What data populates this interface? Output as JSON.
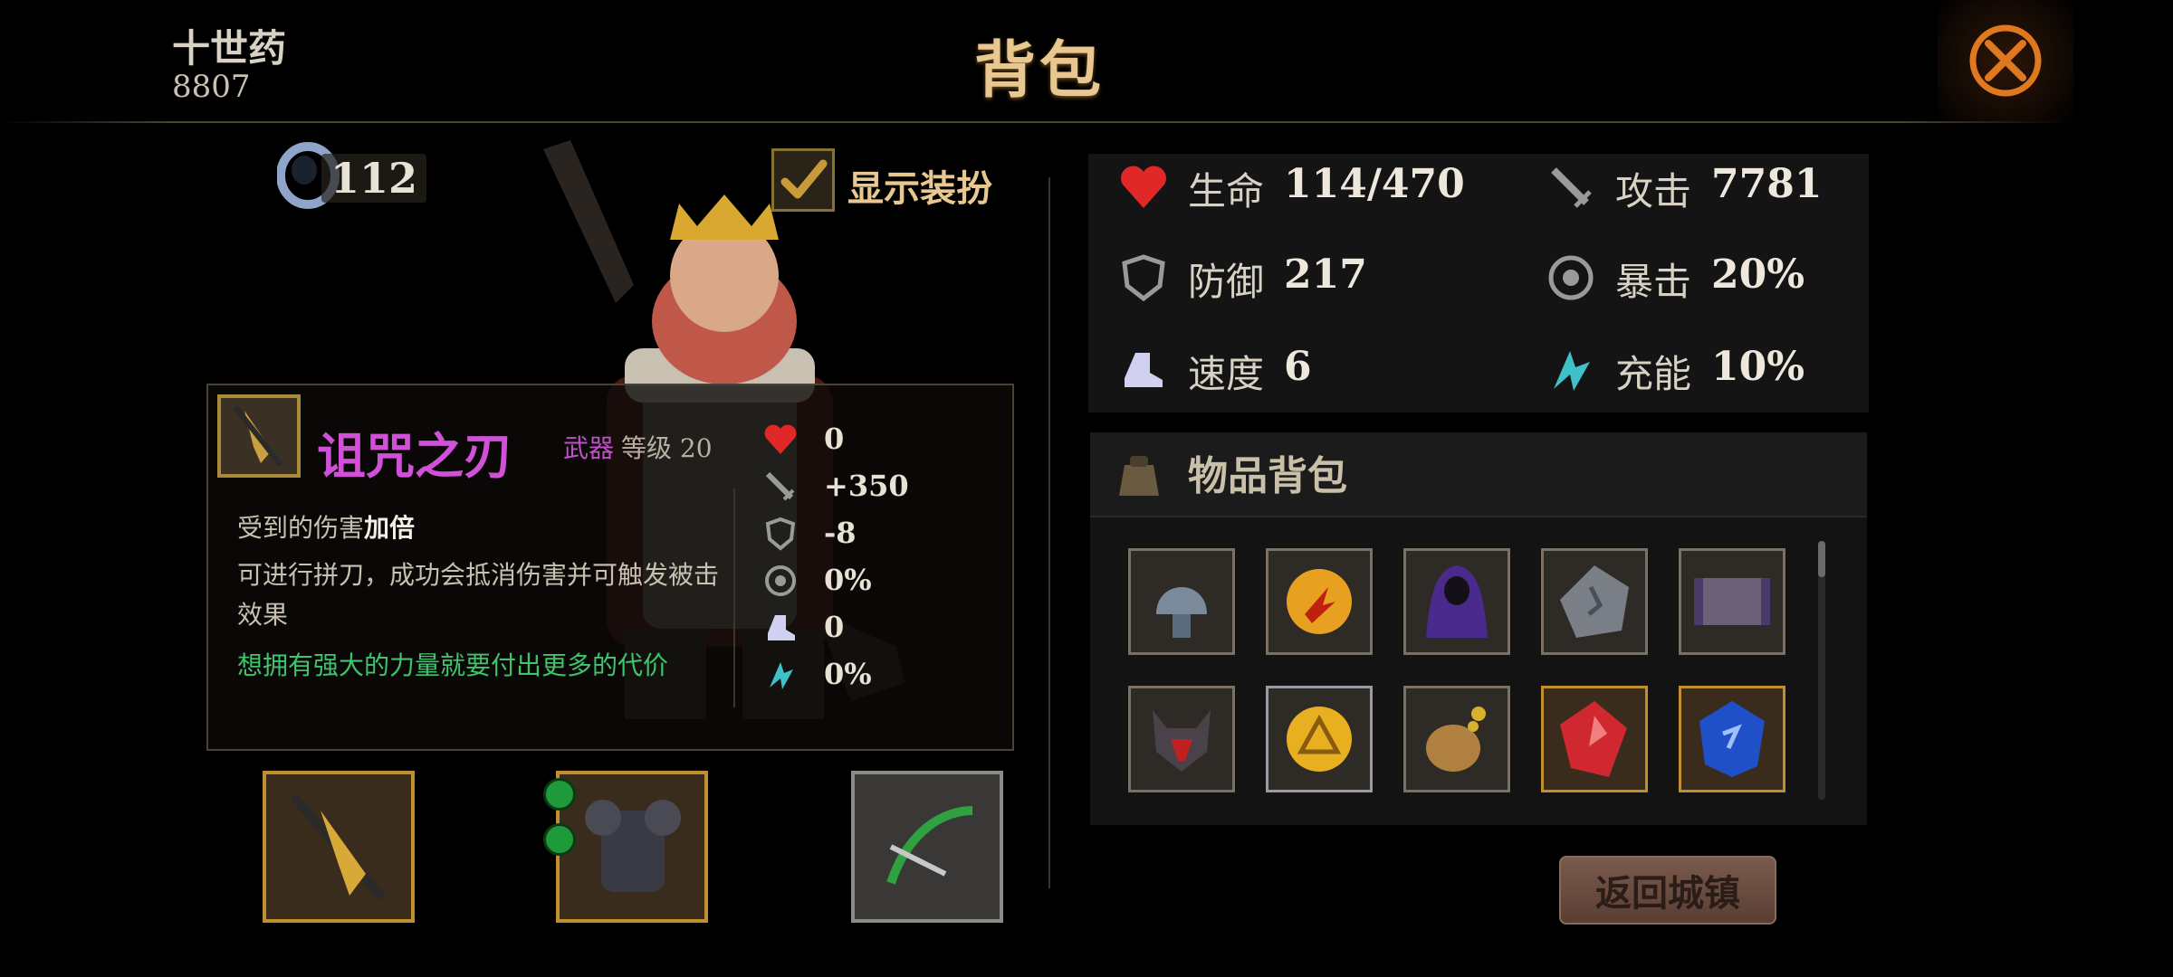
{
  "header": {
    "player_name": "十世药",
    "player_id": "8807",
    "title": "背包"
  },
  "currency": {
    "amount": "112"
  },
  "display_toggle": {
    "label": "显示装扮",
    "checked": true
  },
  "item_tooltip": {
    "name": "诅咒之刃",
    "type": "武器",
    "level_text": "等级 20",
    "desc_prefix": "受到的伤害",
    "desc_bold": "加倍",
    "desc_2": "可进行拼刀，成功会抵消伤害并可触发被击效果",
    "flavor": "想拥有强大的力量就要付出更多的代价",
    "stats": [
      {
        "icon": "heart-icon",
        "value": "0"
      },
      {
        "icon": "sword-icon",
        "value": "+350"
      },
      {
        "icon": "shield-icon",
        "value": "-8"
      },
      {
        "icon": "crit-icon",
        "value": "0%"
      },
      {
        "icon": "boot-icon",
        "value": "0"
      },
      {
        "icon": "energy-icon",
        "value": "0%"
      }
    ]
  },
  "stats": {
    "hp_label": "生命",
    "hp_value": "114/470",
    "atk_label": "攻击",
    "atk_value": "7781",
    "def_label": "防御",
    "def_value": "217",
    "crit_label": "暴击",
    "crit_value": "20%",
    "spd_label": "速度",
    "spd_value": "6",
    "energy_label": "充能",
    "energy_value": "10%"
  },
  "inventory": {
    "title": "物品背包",
    "items": [
      "helmet-icon",
      "fire-orb-icon",
      "hooded-cloak-icon",
      "stone-rune-icon",
      "scroll-icon",
      "demon-helm-icon",
      "gold-coin-icon",
      "pouch-icon",
      "red-gem-icon",
      "blue-gem-icon"
    ]
  },
  "buttons": {
    "return": "返回城镇"
  },
  "colors": {
    "accent_gold": "#e8c890",
    "item_purple": "#d050d8",
    "flavor_green": "#3fc46c"
  }
}
